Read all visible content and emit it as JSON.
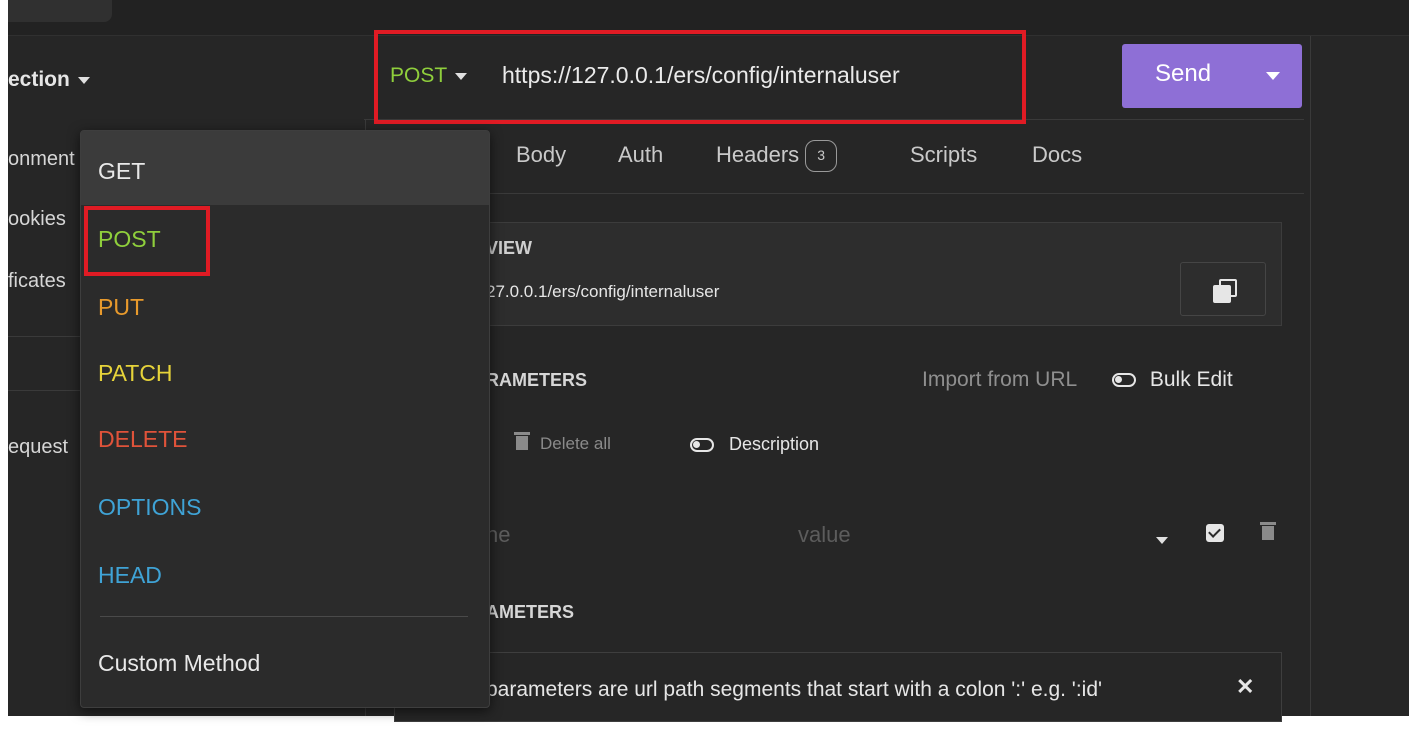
{
  "sidebar": {
    "collection_title": "ection",
    "items": [
      "onment",
      "ookies",
      "ficates"
    ],
    "request_label": "equest"
  },
  "request": {
    "method": "POST",
    "url": "https://127.0.0.1/ers/config/internaluser",
    "send_label": "Send"
  },
  "tabs": {
    "items": [
      "Body",
      "Auth",
      "Headers",
      "Scripts",
      "Docs"
    ],
    "headers_count": "3"
  },
  "url_preview": {
    "label": "VIEW",
    "url": "27.0.0.1/ers/config/internaluser"
  },
  "query_params": {
    "label": "RAMETERS",
    "import_from_url": "Import from URL",
    "bulk_edit": "Bulk Edit",
    "delete_all": "Delete all",
    "description": "Description",
    "name_placeholder": "ne",
    "value_placeholder": "value"
  },
  "path_params": {
    "label": "AMETERS",
    "info_text": "parameters are url path segments that start with a colon ':' e.g. ':id'",
    "close_glyph": "✕"
  },
  "method_dropdown": {
    "items": [
      {
        "label": "GET",
        "color": "#e8e8e8"
      },
      {
        "label": "POST",
        "color": "#8fcf3c"
      },
      {
        "label": "PUT",
        "color": "#e89a2c"
      },
      {
        "label": "PATCH",
        "color": "#e6d33a"
      },
      {
        "label": "DELETE",
        "color": "#e0533a"
      },
      {
        "label": "OPTIONS",
        "color": "#3fa3d6"
      },
      {
        "label": "HEAD",
        "color": "#3fa3d6"
      }
    ],
    "custom_method": "Custom Method"
  },
  "colors": {
    "highlight": "#e01b24",
    "send_button": "#8e6fd6",
    "method_post": "#8fcf3c"
  }
}
